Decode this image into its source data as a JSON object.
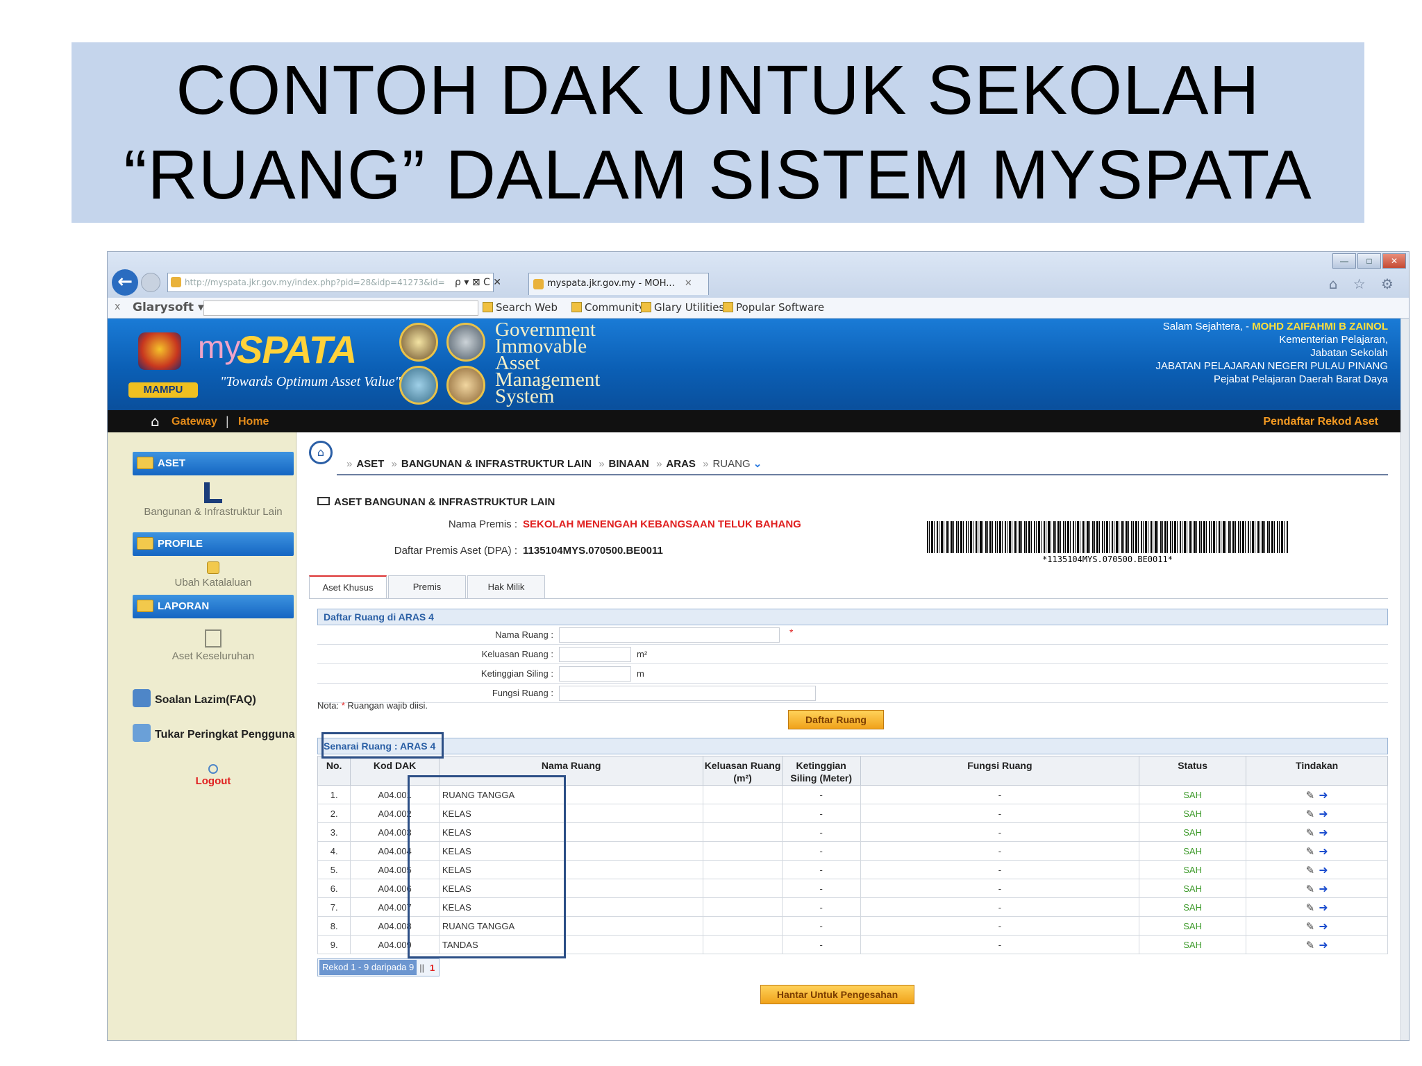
{
  "slide": {
    "title_line1": "CONTOH DAK UNTUK SEKOLAH",
    "title_line2": "“RUANG” DALAM SISTEM MYSPATA"
  },
  "browser": {
    "address": "http://myspata.jkr.gov.my/index.php?pid=28&idp=41273&id=",
    "addr_controls": "ρ ▾ ⊠ C ✕",
    "tab_title": "myspata.jkr.gov.my - MOH...",
    "tab_close": "✕",
    "icons": "⌂ ☆ ⚙"
  },
  "toolbar": {
    "brand": "Glarysoft ▾",
    "items": [
      "Search Web",
      "Community",
      "Glary Utilities",
      "Popular Software"
    ]
  },
  "header": {
    "logo_my": "my",
    "logo_spata": "SPATA",
    "tagline": "\"Towards Optimum Asset Value\"",
    "mampu": "MAMPU",
    "gams_lines": [
      "Government",
      "Immovable",
      "Asset",
      "Management",
      "System"
    ],
    "greeting": "Salam Sejahtera, - ",
    "user_name": "MOHD ZAIFAHMI B ZAINOL",
    "org_lines": [
      "Kementerian Pelajaran,",
      "Jabatan Sekolah",
      "JABATAN PELAJARAN NEGERI PULAU PINANG",
      "Pejabat Pelajaran Daerah Barat Daya"
    ]
  },
  "nav": {
    "gateway": "Gateway",
    "separator": "|",
    "home": "Home",
    "right_link": "Pendaftar Rekod Aset"
  },
  "sidebar": {
    "aset_header": "ASET",
    "aset_item": "Bangunan & Infrastruktur Lain",
    "profile_header": "PROFILE",
    "profile_item": "Ubah Katalaluan",
    "laporan_header": "LAPORAN",
    "laporan_item": "Aset Keseluruhan",
    "faq": "Soalan Lazim(FAQ)",
    "tukar": "Tukar Peringkat Pengguna",
    "logout": "Logout"
  },
  "breadcrumb": [
    "ASET",
    "BANGUNAN & INFRASTRUKTUR LAIN",
    "BINAAN",
    "ARAS",
    "RUANG"
  ],
  "premis": {
    "section_title": "ASET BANGUNAN & INFRASTRUKTUR LAIN",
    "nama_label": "Nama Premis :",
    "nama_value": "SEKOLAH MENENGAH KEBANGSAAN TELUK BAHANG",
    "dpa_label": "Daftar Premis Aset (DPA) :",
    "dpa_value": "1135104MYS.070500.BE0011",
    "barcode_text": "*1135104MYS.070500.BE0011*"
  },
  "tabs": [
    "Aset Khusus",
    "Premis",
    "Hak Milik"
  ],
  "form": {
    "panel_title": "Daftar Ruang di ARAS 4",
    "nama_ruang_label": "Nama Ruang :",
    "keluasan_label": "Keluasan Ruang :",
    "keluasan_unit": "m²",
    "ketinggian_label": "Ketinggian Siling :",
    "ketinggian_unit": "m",
    "fungsi_label": "Fungsi Ruang :",
    "required_mark": "*",
    "note_prefix": "Nota: ",
    "note_star": "*",
    "note_text": " Ruangan wajib diisi.",
    "submit": "Daftar Ruang"
  },
  "list": {
    "panel_title": "Senarai Ruang : ARAS 4",
    "columns": [
      "No.",
      "Kod DAK",
      "Nama Ruang",
      "Keluasan Ruang (m²)",
      "Ketinggian Siling (Meter)",
      "Fungsi Ruang",
      "Status",
      "Tindakan"
    ],
    "rows": [
      {
        "no": "1.",
        "kod": "A04.001",
        "nama": "RUANG TANGGA",
        "keluasan": "",
        "ketinggian": "-",
        "fungsi": "-",
        "status": "SAH"
      },
      {
        "no": "2.",
        "kod": "A04.002",
        "nama": "KELAS",
        "keluasan": "",
        "ketinggian": "-",
        "fungsi": "-",
        "status": "SAH"
      },
      {
        "no": "3.",
        "kod": "A04.003",
        "nama": "KELAS",
        "keluasan": "",
        "ketinggian": "-",
        "fungsi": "-",
        "status": "SAH"
      },
      {
        "no": "4.",
        "kod": "A04.004",
        "nama": "KELAS",
        "keluasan": "",
        "ketinggian": "-",
        "fungsi": "-",
        "status": "SAH"
      },
      {
        "no": "5.",
        "kod": "A04.005",
        "nama": "KELAS",
        "keluasan": "",
        "ketinggian": "-",
        "fungsi": "-",
        "status": "SAH"
      },
      {
        "no": "6.",
        "kod": "A04.006",
        "nama": "KELAS",
        "keluasan": "",
        "ketinggian": "-",
        "fungsi": "-",
        "status": "SAH"
      },
      {
        "no": "7.",
        "kod": "A04.007",
        "nama": "KELAS",
        "keluasan": "",
        "ketinggian": "-",
        "fungsi": "-",
        "status": "SAH"
      },
      {
        "no": "8.",
        "kod": "A04.008",
        "nama": "RUANG TANGGA",
        "keluasan": "",
        "ketinggian": "-",
        "fungsi": "-",
        "status": "SAH"
      },
      {
        "no": "9.",
        "kod": "A04.009",
        "nama": "TANDAS",
        "keluasan": "",
        "ketinggian": "-",
        "fungsi": "-",
        "status": "SAH"
      }
    ],
    "pager_info": "Rekod 1 - 9 daripada 9",
    "pager_sep": "||",
    "pager_page": "1",
    "submit": "Hantar Untuk Pengesahan"
  },
  "colors": {
    "title_bg": "#c5d5ec",
    "banner": "#0b5fb5",
    "sidebar_bg": "#eeeccf",
    "status_green": "#3d9a2a",
    "highlight_box": "#2c4f86"
  },
  "icons": {
    "back": "back-arrow-icon",
    "home": "home-icon",
    "edit": "pencil-icon",
    "go": "arrow-right-icon",
    "folder": "folder-icon"
  }
}
